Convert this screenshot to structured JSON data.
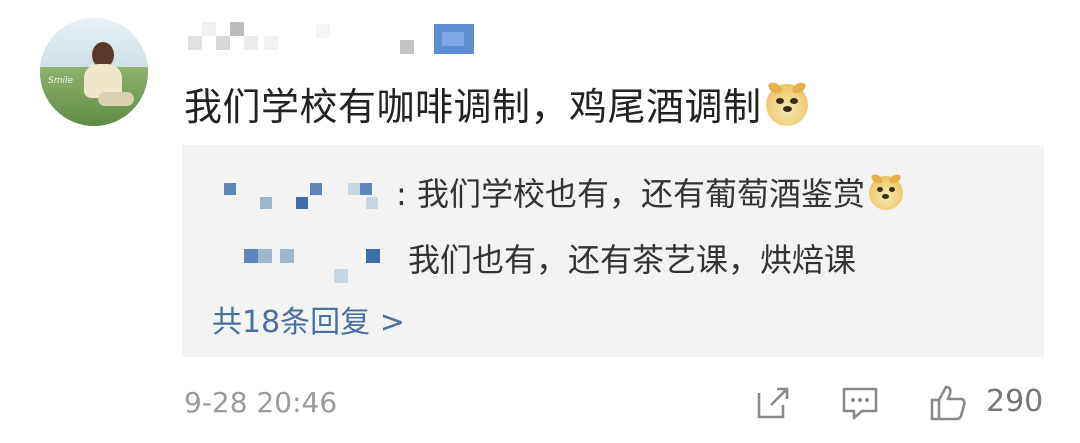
{
  "comment": {
    "username": "",
    "text": "我们学校有咖啡调制，鸡尾酒调制",
    "emoji": "doge-icon",
    "time": "9-28 20:46",
    "likes": "290"
  },
  "replies": {
    "items": [
      {
        "separator": ":",
        "text": " 我们学校也有，还有葡萄酒鉴赏",
        "emoji": "doge-icon"
      },
      {
        "text": "我们也有，还有茶艺课，烘焙课"
      }
    ],
    "more_label": "共18条回复 >"
  },
  "colors": {
    "link": "#4a6fa1",
    "reply_bg": "#f3f3f3",
    "mosaic": [
      "#3e6fa8",
      "#9fb6d1",
      "#c9d6e4",
      "#5f86b8"
    ]
  },
  "icons": [
    "share-icon",
    "comment-icon",
    "like-icon"
  ]
}
